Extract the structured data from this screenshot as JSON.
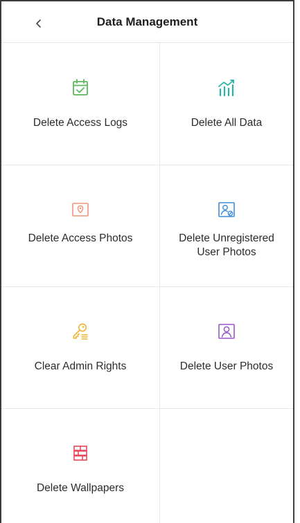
{
  "header": {
    "title": "Data Management",
    "back_icon": "chevron-left-icon"
  },
  "tiles": [
    {
      "label": "Delete Access Logs",
      "icon": "calendar-check-icon",
      "color": "#5cb85c"
    },
    {
      "label": "Delete All Data",
      "icon": "chart-trend-icon",
      "color": "#27b3a3"
    },
    {
      "label": "Delete Access Photos",
      "icon": "location-photo-icon",
      "color": "#f0937a"
    },
    {
      "label": "Delete Unregistered User Photos",
      "icon": "user-photo-blocked-icon",
      "color": "#3f8ed8"
    },
    {
      "label": "Clear Admin Rights",
      "icon": "key-list-icon",
      "color": "#f2b230"
    },
    {
      "label": "Delete User Photos",
      "icon": "user-photo-icon",
      "color": "#9a56c9"
    },
    {
      "label": "Delete Wallpapers",
      "icon": "wallpaper-brick-icon",
      "color": "#e8485e"
    }
  ]
}
